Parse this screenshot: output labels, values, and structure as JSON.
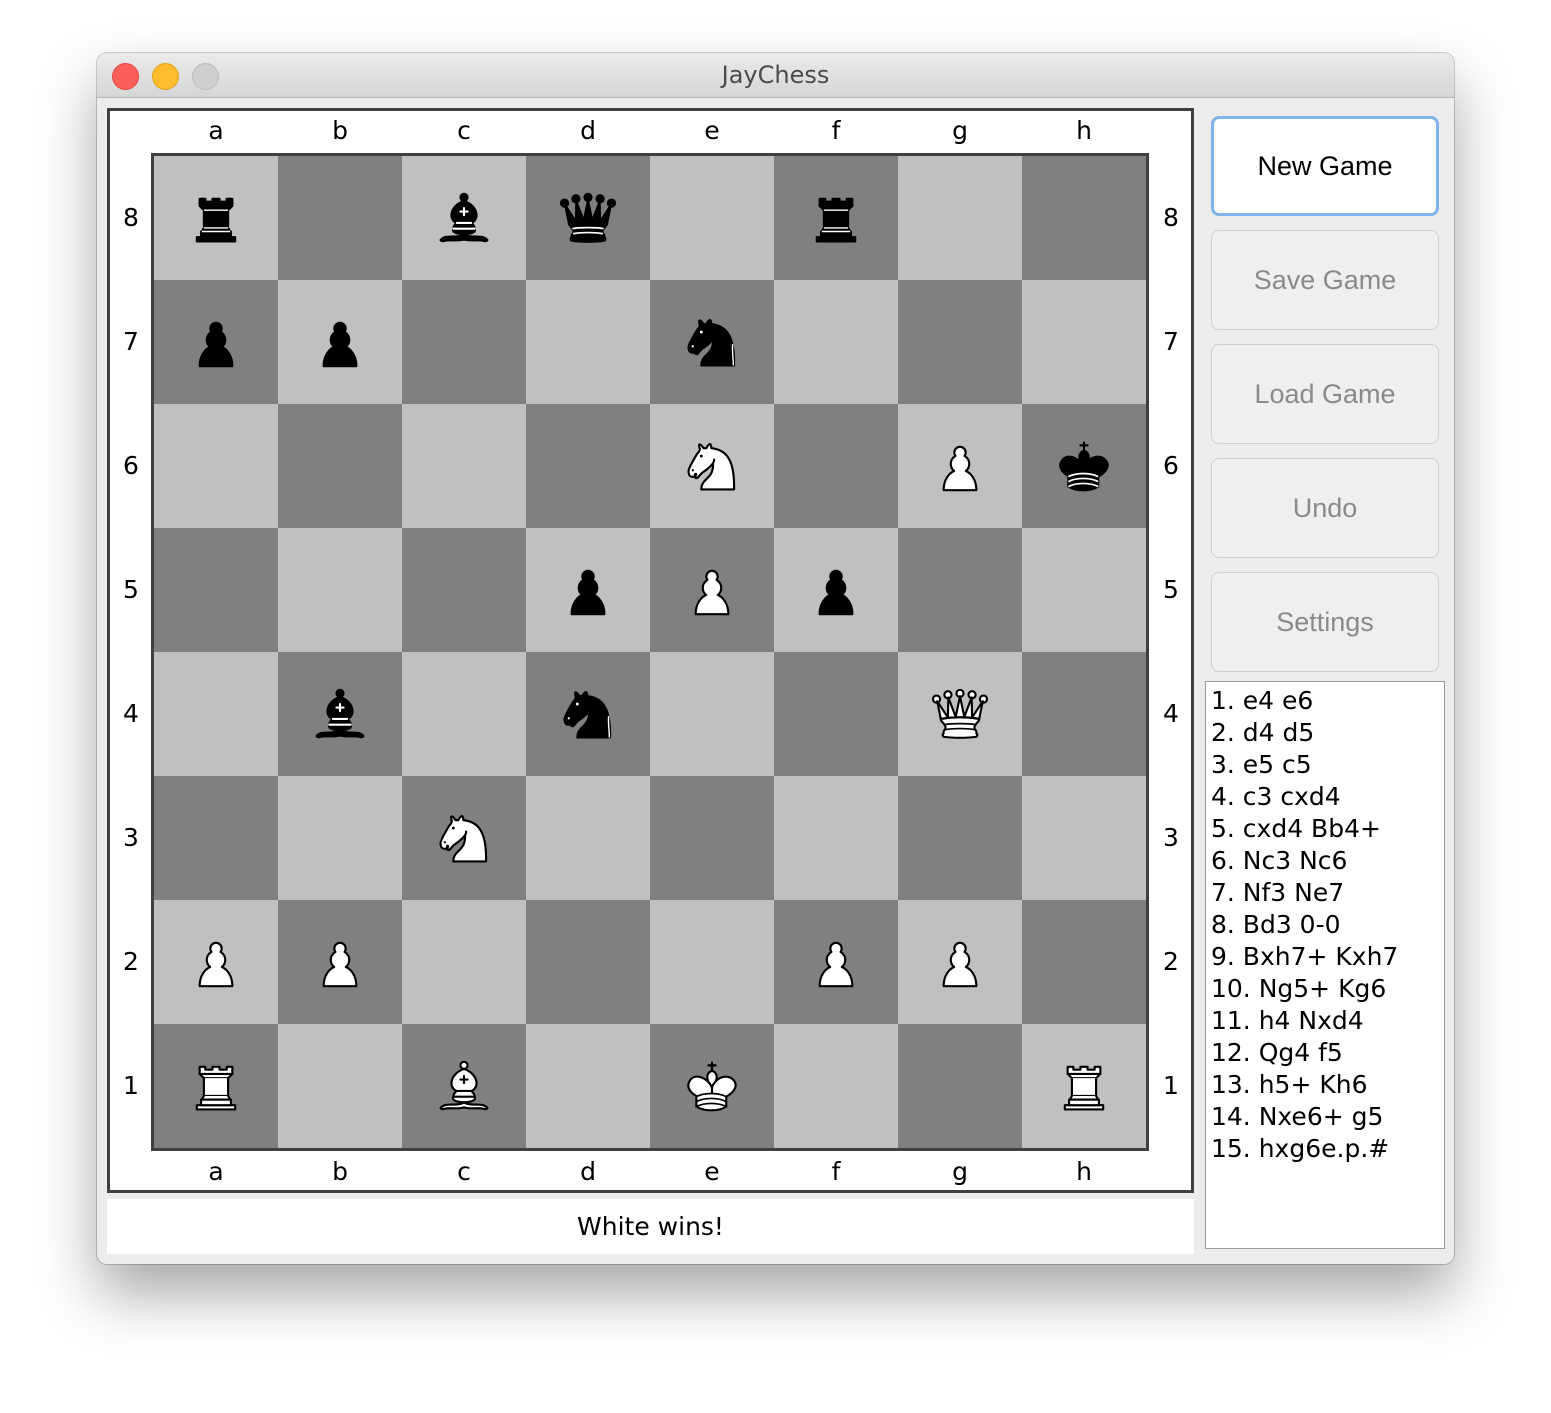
{
  "window": {
    "title": "JayChess"
  },
  "board": {
    "files": [
      "a",
      "b",
      "c",
      "d",
      "e",
      "f",
      "g",
      "h"
    ],
    "ranks": [
      "8",
      "7",
      "6",
      "5",
      "4",
      "3",
      "2",
      "1"
    ],
    "squares": [
      [
        "br",
        "",
        "bb",
        "bq",
        "",
        "br",
        "",
        ""
      ],
      [
        "bp",
        "bp",
        "",
        "",
        "bn",
        "",
        "",
        ""
      ],
      [
        "",
        "",
        "",
        "",
        "wn",
        "",
        "wp",
        "bk"
      ],
      [
        "",
        "",
        "",
        "bp",
        "wp",
        "bp",
        "",
        ""
      ],
      [
        "",
        "bb",
        "",
        "bn",
        "",
        "",
        "wq",
        ""
      ],
      [
        "",
        "",
        "wn",
        "",
        "",
        "",
        "",
        ""
      ],
      [
        "wp",
        "wp",
        "",
        "",
        "",
        "wp",
        "wp",
        ""
      ],
      [
        "wr",
        "",
        "wb",
        "",
        "wk",
        "",
        "",
        "wr"
      ]
    ],
    "light_color": "#c0c0c0",
    "dark_color": "#808080"
  },
  "status": "White wins!",
  "buttons": {
    "new_game": "New Game",
    "save_game": "Save Game",
    "load_game": "Load Game",
    "undo": "Undo",
    "settings": "Settings"
  },
  "moves": [
    "1. e4 e6",
    "2. d4 d5",
    "3. e5 c5",
    "4. c3 cxd4",
    "5. cxd4 Bb4+",
    "6. Nc3 Nc6",
    "7. Nf3 Ne7",
    "8. Bd3 0-0",
    "9. Bxh7+ Kxh7",
    "10. Ng5+ Kg6",
    "11. h4 Nxd4",
    "12. Qg4 f5",
    "13. h5+ Kh6",
    "14. Nxe6+ g5",
    "15. hxg6e.p.#"
  ]
}
